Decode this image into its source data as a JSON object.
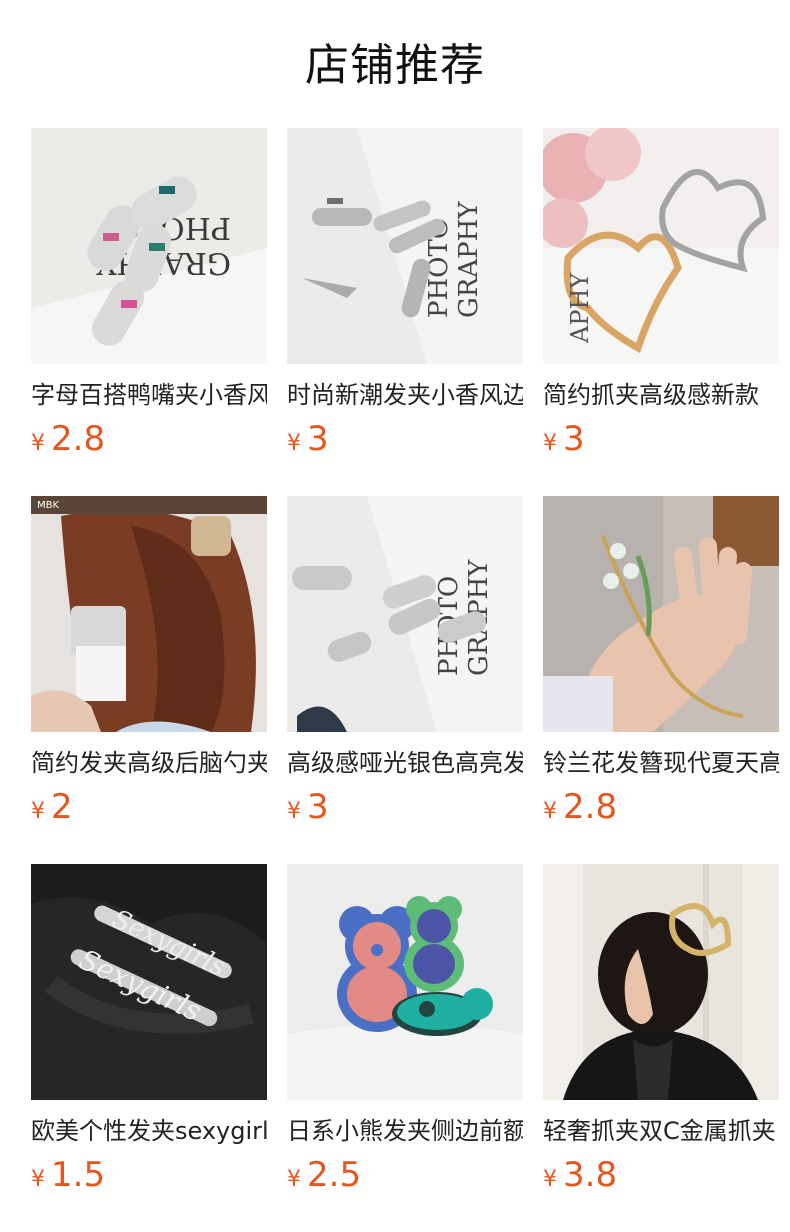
{
  "section": {
    "title": "店铺推荐"
  },
  "currency_symbol": "¥",
  "products": [
    {
      "name": "字母百搭鸭嘴夹小香风",
      "price": "2.8",
      "image": "letter-duckbill-clips-photo"
    },
    {
      "name": "时尚新潮发夹小香风边",
      "price": "3",
      "image": "silver-snap-clips-photo"
    },
    {
      "name": "简约抓夹高级感新款",
      "price": "3",
      "image": "butterfly-claw-clips-photo"
    },
    {
      "name": "简约发夹高级后脑勺夹",
      "price": "2",
      "image": "hair-clip-model-photo"
    },
    {
      "name": "高级感哑光银色高亮发",
      "price": "3",
      "image": "matte-silver-clips-photo"
    },
    {
      "name": "铃兰花发簪现代夏天高",
      "price": "2.8",
      "image": "lily-of-valley-hairpin-photo"
    },
    {
      "name": "欧美个性发夹sexygirl",
      "price": "1.5",
      "image": "sexygirls-letter-clips-photo"
    },
    {
      "name": "日系小熊发夹侧边前额",
      "price": "2.5",
      "image": "bear-hair-clips-photo"
    },
    {
      "name": "轻奢抓夹双C金属抓夹",
      "price": "3.8",
      "image": "gold-claw-clip-model-photo"
    }
  ]
}
